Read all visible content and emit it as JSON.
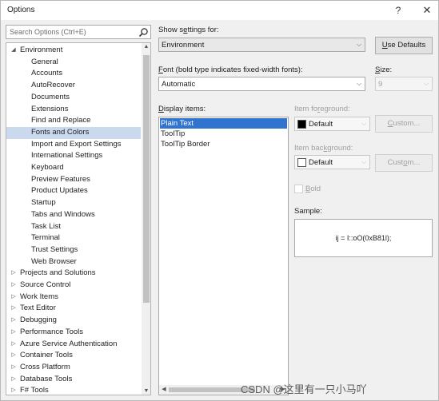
{
  "window": {
    "title": "Options",
    "help_label": "?",
    "close_label": "✕"
  },
  "search": {
    "placeholder": "Search Options (Ctrl+E)"
  },
  "tree": {
    "items": [
      {
        "label": "Environment",
        "level": 0,
        "expanded": true
      },
      {
        "label": "General",
        "level": 1
      },
      {
        "label": "Accounts",
        "level": 1
      },
      {
        "label": "AutoRecover",
        "level": 1
      },
      {
        "label": "Documents",
        "level": 1
      },
      {
        "label": "Extensions",
        "level": 1
      },
      {
        "label": "Find and Replace",
        "level": 1
      },
      {
        "label": "Fonts and Colors",
        "level": 1,
        "selected": true
      },
      {
        "label": "Import and Export Settings",
        "level": 1
      },
      {
        "label": "International Settings",
        "level": 1
      },
      {
        "label": "Keyboard",
        "level": 1
      },
      {
        "label": "Preview Features",
        "level": 1
      },
      {
        "label": "Product Updates",
        "level": 1
      },
      {
        "label": "Startup",
        "level": 1
      },
      {
        "label": "Tabs and Windows",
        "level": 1
      },
      {
        "label": "Task List",
        "level": 1
      },
      {
        "label": "Terminal",
        "level": 1
      },
      {
        "label": "Trust Settings",
        "level": 1
      },
      {
        "label": "Web Browser",
        "level": 1
      },
      {
        "label": "Projects and Solutions",
        "level": 0,
        "expanded": false
      },
      {
        "label": "Source Control",
        "level": 0,
        "expanded": false
      },
      {
        "label": "Work Items",
        "level": 0,
        "expanded": false
      },
      {
        "label": "Text Editor",
        "level": 0,
        "expanded": false
      },
      {
        "label": "Debugging",
        "level": 0,
        "expanded": false
      },
      {
        "label": "Performance Tools",
        "level": 0,
        "expanded": false
      },
      {
        "label": "Azure Service Authentication",
        "level": 0,
        "expanded": false
      },
      {
        "label": "Container Tools",
        "level": 0,
        "expanded": false
      },
      {
        "label": "Cross Platform",
        "level": 0,
        "expanded": false
      },
      {
        "label": "Database Tools",
        "level": 0,
        "expanded": false
      },
      {
        "label": "F# Tools",
        "level": 0,
        "expanded": false
      }
    ]
  },
  "show_settings": {
    "label_pre": "Show s",
    "label_key": "e",
    "label_post": "ttings for:",
    "value": "Environment",
    "use_defaults_key": "U",
    "use_defaults_rest": "se Defaults"
  },
  "font": {
    "label_key": "F",
    "label_post": "ont (bold type indicates fixed-width fonts):",
    "value": "Automatic",
    "size_label_key": "S",
    "size_label_post": "ize:",
    "size_value": "9"
  },
  "display_items": {
    "label_key": "D",
    "label_post": "isplay items:",
    "items": [
      {
        "label": "Plain Text",
        "selected": true
      },
      {
        "label": "ToolTip"
      },
      {
        "label": "ToolTip Border"
      }
    ]
  },
  "foreground": {
    "label_pre": "Item fo",
    "label_key": "r",
    "label_post": "eground:",
    "value": "Default",
    "swatch_color": "#000000",
    "custom_pre": "",
    "custom_key": "C",
    "custom_post": "ustom..."
  },
  "background": {
    "label_pre": "Item bac",
    "label_key": "k",
    "label_post": "ground:",
    "value": "Default",
    "swatch_color": "#ffffff",
    "custom_pre": "Cust",
    "custom_key": "o",
    "custom_post": "m..."
  },
  "bold": {
    "label_key": "B",
    "label_post": "old"
  },
  "sample": {
    "label": "Sample:",
    "text": "ij = I::oO(0xB81l);"
  },
  "watermark": {
    "text": "CSDN @这里有一只小马吖"
  },
  "colors": {
    "selection": "#3074d0",
    "tree_selection": "#cbd9ee"
  }
}
